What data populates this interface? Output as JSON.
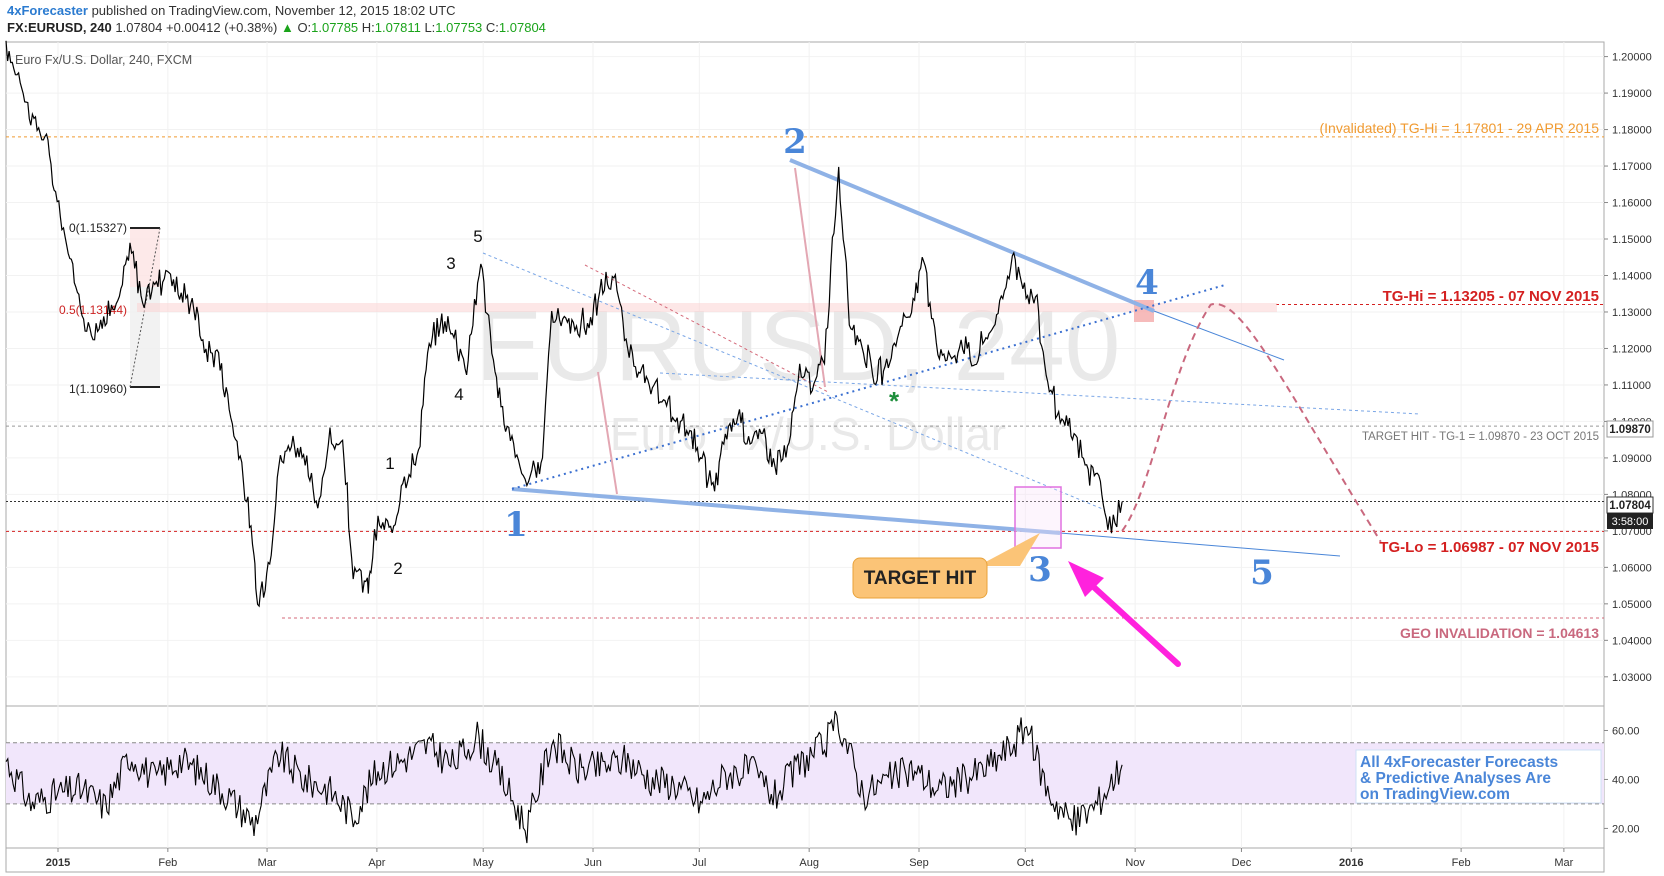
{
  "header": {
    "author": "4xForecaster",
    "published": "published on TradingView.com, November 12, 2015 18:02 UTC",
    "symbol": "FX:EURUSD, 240",
    "last": "1.07804",
    "change": "+0.00412 (+0.38%)",
    "o_label": "O:",
    "o_value": "1.07785",
    "h_label": "H:",
    "h_value": "1.07811",
    "l_label": "L:",
    "l_value": "1.07753",
    "c_label": "C:",
    "c_value": "1.07804"
  },
  "chart": {
    "series_title": "Euro Fx/U.S. Dollar, 240, FXCM",
    "watermark_symbol": "EURUSD, 240",
    "watermark_name": "Euro Fx/U.S. Dollar",
    "price_badge": "1.07804",
    "time_badge": "3:58:00",
    "tg1_badge": "1.09870",
    "label_tg_hi_old": "(Invalidated) TG-Hi = 1.17801 - 29 APR 2015",
    "label_tg_hi": "TG-Hi = 1.13205 - 07 NOV 2015",
    "label_target_tg1": "TARGET HIT - TG-1 = 1.09870 - 23 OCT 2015",
    "label_tg_lo": "TG-Lo = 1.06987 - 07 NOV 2015",
    "label_geo": "GEO INVALIDATION = 1.04613",
    "fib_0": "0(1.15327)",
    "fib_05": "0.5(1.13144)",
    "fib_1": "1(1.10960)",
    "callout": "TARGET HIT",
    "promo_lines": [
      "All 4xForecaster Forecasts",
      "& Predictive Analyses Are",
      "on TradingView.com"
    ],
    "big_waves": [
      "1",
      "2",
      "3",
      "4",
      "5"
    ],
    "small_waves": [
      "1",
      "2",
      "3",
      "4",
      "5"
    ],
    "star": "*"
  },
  "chart_data": {
    "type": "line",
    "title": "Euro Fx/U.S. Dollar, 240, FXCM",
    "xlabel": "",
    "ylabel": "",
    "x_ticks": [
      "2015",
      "Feb",
      "Mar",
      "Apr",
      "May",
      "Jun",
      "Jul",
      "Aug",
      "Sep",
      "Oct",
      "Nov",
      "Dec",
      "2016",
      "Feb",
      "Mar"
    ],
    "y_ticks": [
      "1.03000",
      "1.04000",
      "1.05000",
      "1.06000",
      "1.07000",
      "1.08000",
      "1.09000",
      "1.10000",
      "1.11000",
      "1.12000",
      "1.13000",
      "1.14000",
      "1.15000",
      "1.16000",
      "1.17000",
      "1.18000",
      "1.19000",
      "1.20000"
    ],
    "ylim": [
      1.022,
      1.204
    ],
    "x_range": [
      "2015-01-01",
      "2016-03-27"
    ],
    "series": [
      {
        "x": [
          "2015-01-01",
          "2015-01-05",
          "2015-01-08",
          "2015-01-12",
          "2015-01-15",
          "2015-01-19",
          "2015-01-22",
          "2015-01-26",
          "2015-01-29",
          "2015-02-02",
          "2015-02-05",
          "2015-02-09",
          "2015-02-12",
          "2015-02-16",
          "2015-02-19",
          "2015-02-23",
          "2015-02-26",
          "2015-03-02",
          "2015-03-05",
          "2015-03-09",
          "2015-03-12",
          "2015-03-13",
          "2015-03-16",
          "2015-03-19",
          "2015-03-23",
          "2015-03-26",
          "2015-03-30",
          "2015-04-02",
          "2015-04-06",
          "2015-04-09",
          "2015-04-13",
          "2015-04-14",
          "2015-04-16",
          "2015-04-20",
          "2015-04-23",
          "2015-04-27",
          "2015-04-30",
          "2015-05-04",
          "2015-05-07",
          "2015-05-11",
          "2015-05-15",
          "2015-05-19",
          "2015-05-22",
          "2015-05-27",
          "2015-05-29",
          "2015-06-01",
          "2015-06-04",
          "2015-06-08",
          "2015-06-11",
          "2015-06-15",
          "2015-06-18",
          "2015-06-22",
          "2015-06-25",
          "2015-06-29",
          "2015-07-02",
          "2015-07-06",
          "2015-07-09",
          "2015-07-13",
          "2015-07-16",
          "2015-07-20",
          "2015-07-23",
          "2015-07-27",
          "2015-07-30",
          "2015-08-03",
          "2015-08-06",
          "2015-08-10",
          "2015-08-13",
          "2015-08-17",
          "2015-08-20",
          "2015-08-24",
          "2015-08-27",
          "2015-08-31",
          "2015-09-03",
          "2015-09-07",
          "2015-09-10",
          "2015-09-14",
          "2015-09-17",
          "2015-09-21",
          "2015-09-24",
          "2015-09-28",
          "2015-10-01",
          "2015-10-05",
          "2015-10-08",
          "2015-10-12",
          "2015-10-15",
          "2015-10-19",
          "2015-10-22",
          "2015-10-26",
          "2015-10-29",
          "2015-11-02",
          "2015-11-05",
          "2015-11-08",
          "2015-11-10",
          "2015-11-12"
        ],
        "y": [
          1.202,
          1.194,
          1.183,
          1.178,
          1.162,
          1.145,
          1.132,
          1.123,
          1.129,
          1.133,
          1.148,
          1.132,
          1.138,
          1.141,
          1.135,
          1.132,
          1.12,
          1.118,
          1.105,
          1.085,
          1.062,
          1.049,
          1.06,
          1.088,
          1.095,
          1.09,
          1.076,
          1.095,
          1.093,
          1.058,
          1.055,
          1.06,
          1.072,
          1.07,
          1.085,
          1.09,
          1.118,
          1.128,
          1.125,
          1.115,
          1.145,
          1.112,
          1.099,
          1.085,
          1.084,
          1.087,
          1.13,
          1.127,
          1.126,
          1.127,
          1.137,
          1.139,
          1.12,
          1.113,
          1.108,
          1.105,
          1.1,
          1.098,
          1.089,
          1.082,
          1.096,
          1.103,
          1.094,
          1.097,
          1.088,
          1.093,
          1.114,
          1.109,
          1.118,
          1.169,
          1.128,
          1.121,
          1.111,
          1.116,
          1.125,
          1.131,
          1.145,
          1.12,
          1.117,
          1.122,
          1.116,
          1.124,
          1.13,
          1.145,
          1.137,
          1.132,
          1.11,
          1.1,
          1.097,
          1.087,
          1.085,
          1.071,
          1.072,
          1.078
        ]
      }
    ],
    "horizontal_levels": [
      {
        "label": "(Invalidated) TG-Hi",
        "value": 1.17801
      },
      {
        "label": "TG-Hi",
        "value": 1.13205
      },
      {
        "label": "TARGET HIT - TG-1",
        "value": 1.0987
      },
      {
        "label": "last",
        "value": 1.07804
      },
      {
        "label": "TG-Lo",
        "value": 1.06987
      },
      {
        "label": "GEO INVALIDATION",
        "value": 1.04613
      }
    ],
    "fib_levels": [
      1.15327,
      1.13144,
      1.1096
    ],
    "projection": [
      {
        "x": "2015-11-12",
        "y": 1.07
      },
      {
        "x": "2015-11-20",
        "y": 1.08
      },
      {
        "x": "2015-12-07",
        "y": 1.132
      },
      {
        "x": "2015-12-22",
        "y": 1.11
      },
      {
        "x": "2016-01-24",
        "y": 1.067
      }
    ],
    "rsi": {
      "y_ticks": [
        "20.00",
        "40.00",
        "60.00"
      ],
      "ylim": [
        12,
        70
      ],
      "band": [
        30,
        55
      ],
      "x": [
        "2015-01-01",
        "2015-01-08",
        "2015-01-15",
        "2015-01-22",
        "2015-01-29",
        "2015-02-05",
        "2015-02-12",
        "2015-02-19",
        "2015-02-26",
        "2015-03-05",
        "2015-03-12",
        "2015-03-19",
        "2015-03-26",
        "2015-04-02",
        "2015-04-09",
        "2015-04-16",
        "2015-04-23",
        "2015-04-30",
        "2015-05-07",
        "2015-05-14",
        "2015-05-21",
        "2015-05-28",
        "2015-06-04",
        "2015-06-11",
        "2015-06-18",
        "2015-06-25",
        "2015-07-02",
        "2015-07-09",
        "2015-07-16",
        "2015-07-23",
        "2015-07-30",
        "2015-08-06",
        "2015-08-13",
        "2015-08-20",
        "2015-08-24",
        "2015-08-31",
        "2015-09-07",
        "2015-09-14",
        "2015-09-21",
        "2015-09-28",
        "2015-10-05",
        "2015-10-12",
        "2015-10-16",
        "2015-10-22",
        "2015-10-29",
        "2015-11-05",
        "2015-11-12"
      ],
      "values": [
        48,
        30,
        34,
        36,
        29,
        50,
        40,
        48,
        42,
        33,
        22,
        50,
        40,
        36,
        25,
        44,
        48,
        54,
        46,
        58,
        40,
        20,
        56,
        44,
        45,
        48,
        40,
        38,
        30,
        42,
        44,
        33,
        46,
        54,
        64,
        34,
        40,
        44,
        36,
        40,
        45,
        54,
        62,
        35,
        22,
        30,
        46
      ]
    }
  }
}
